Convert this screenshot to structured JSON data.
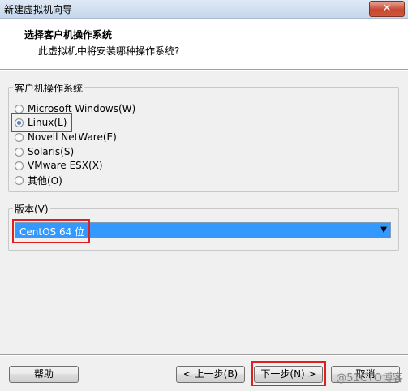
{
  "window": {
    "title": "新建虚拟机向导",
    "close_label": "✕"
  },
  "header": {
    "title": "选择客户机操作系统",
    "subtitle": "此虚拟机中将安装哪种操作系统?"
  },
  "os_group": {
    "label": "客户机操作系统",
    "options": [
      {
        "label": "Microsoft Windows(W)",
        "checked": false
      },
      {
        "label": "Linux(L)",
        "checked": true
      },
      {
        "label": "Novell NetWare(E)",
        "checked": false
      },
      {
        "label": "Solaris(S)",
        "checked": false
      },
      {
        "label": "VMware ESX(X)",
        "checked": false
      },
      {
        "label": "其他(O)",
        "checked": false
      }
    ]
  },
  "version_group": {
    "label": "版本(V)",
    "selected": "CentOS 64 位"
  },
  "buttons": {
    "help": "帮助",
    "back": "< 上一步(B)",
    "next": "下一步(N) >",
    "cancel": "取消"
  },
  "watermark": "@51CTO博客",
  "colors": {
    "highlight": "#e02020",
    "selection": "#3399ff"
  }
}
